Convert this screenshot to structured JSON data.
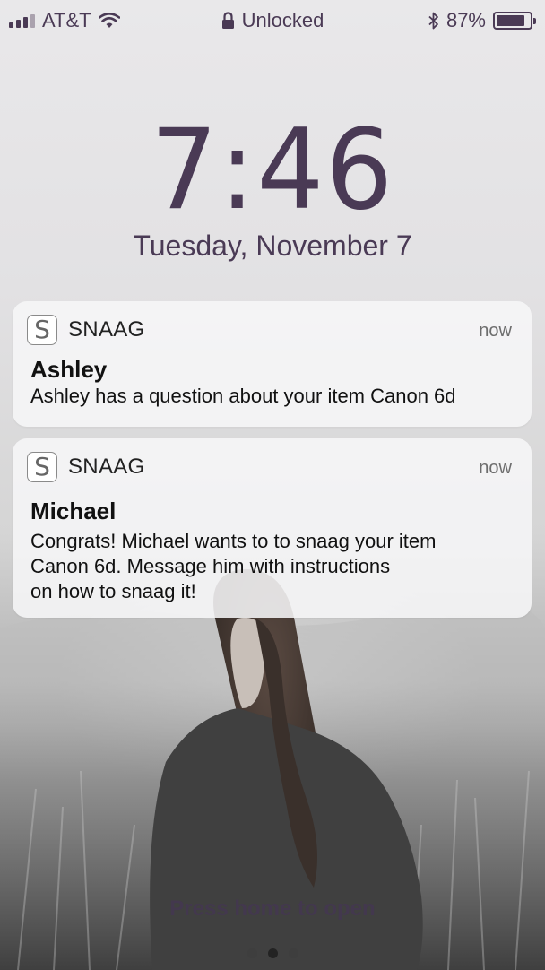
{
  "status_bar": {
    "carrier": "AT&T",
    "lock_status": "Unlocked",
    "battery_percent": "87%",
    "battery_level": 0.87,
    "icons": [
      "signal-bars-icon",
      "wifi-icon",
      "lock-icon",
      "bluetooth-icon",
      "battery-icon"
    ]
  },
  "lockscreen": {
    "time": "7:46",
    "date": "Tuesday, November 7",
    "hint": "Press home to open"
  },
  "notifications": [
    {
      "app_icon": "S",
      "app_name": "SNAAG",
      "time": "now",
      "title": "Ashley",
      "body": "Ashley has a question about your item Canon 6d"
    },
    {
      "app_icon": "S",
      "app_name": "SNAAG",
      "time": "now",
      "title": "Michael",
      "body": "Congrats!  Michael wants to to snaag your item\nCanon 6d.  Message him with instructions\non how to snaag it!"
    }
  ],
  "page_dots": {
    "count": 3,
    "active_index": 1
  },
  "colors": {
    "text_primary": "#4a3a55",
    "notification_bg": "#f6f6f7"
  }
}
